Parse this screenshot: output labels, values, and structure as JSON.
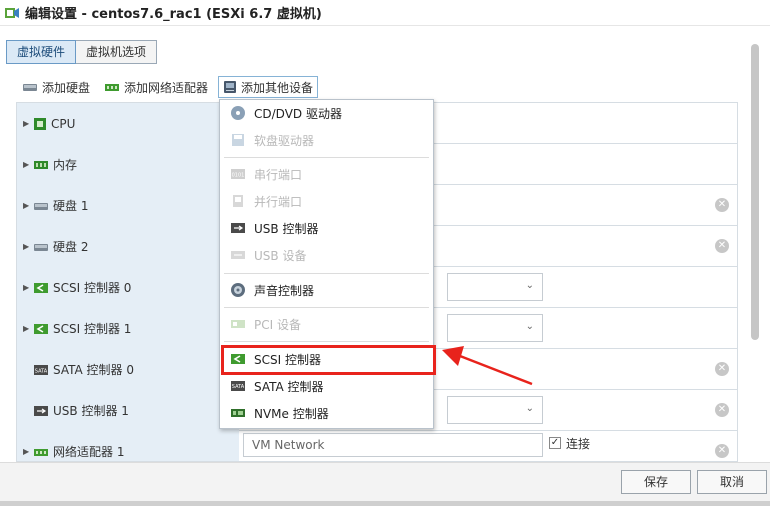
{
  "window": {
    "title": "编辑设置 - centos7.6_rac1 (ESXi 6.7 虚拟机)",
    "icon": "vm-edit-icon"
  },
  "tabs": [
    {
      "label": "虚拟硬件",
      "active": true
    },
    {
      "label": "虚拟机选项",
      "active": false
    }
  ],
  "toolbar": {
    "add_disk": "添加硬盘",
    "add_nic": "添加网络适配器",
    "add_other": "添加其他设备"
  },
  "hardware": [
    {
      "label": "CPU",
      "expandable": true,
      "icon": "cpu-icon"
    },
    {
      "label": "内存",
      "expandable": true,
      "icon": "memory-icon"
    },
    {
      "label": "硬盘 1",
      "expandable": true,
      "icon": "disk-icon"
    },
    {
      "label": "硬盘 2",
      "expandable": true,
      "icon": "disk-icon"
    },
    {
      "label": "SCSI 控制器 0",
      "expandable": true,
      "icon": "scsi-icon"
    },
    {
      "label": "SCSI 控制器 1",
      "expandable": true,
      "icon": "scsi-icon"
    },
    {
      "label": "SATA 控制器 0",
      "expandable": false,
      "icon": "sata-icon"
    },
    {
      "label": "USB 控制器 1",
      "expandable": false,
      "icon": "usb-icon"
    },
    {
      "label": "网络适配器 1",
      "expandable": true,
      "icon": "nic-icon"
    }
  ],
  "network": {
    "value": "VM Network",
    "connect_label": "连接",
    "connected": true
  },
  "menu": {
    "items": [
      {
        "label": "CD/DVD 驱动器",
        "enabled": true,
        "icon": "cdrom-icon"
      },
      {
        "label": "软盘驱动器",
        "enabled": false,
        "icon": "floppy-icon"
      },
      {
        "label": "串行端口",
        "enabled": false,
        "icon": "serial-port-icon"
      },
      {
        "label": "并行端口",
        "enabled": false,
        "icon": "parallel-port-icon"
      },
      {
        "label": "USB 控制器",
        "enabled": true,
        "icon": "usb-icon"
      },
      {
        "label": "USB 设备",
        "enabled": false,
        "icon": "usb-device-icon"
      },
      {
        "label": "声音控制器",
        "enabled": true,
        "icon": "sound-icon"
      },
      {
        "label": "PCI 设备",
        "enabled": false,
        "icon": "pci-icon"
      },
      {
        "label": "SCSI 控制器",
        "enabled": true,
        "icon": "scsi-icon"
      },
      {
        "label": "SATA 控制器",
        "enabled": true,
        "icon": "sata-icon"
      },
      {
        "label": "NVMe 控制器",
        "enabled": true,
        "icon": "nvme-icon"
      }
    ]
  },
  "footer": {
    "save": "保存",
    "cancel": "取消"
  },
  "colors": {
    "accent": "#1d4c7a",
    "highlight": "#e8231c",
    "device_green": "#3f9b2f"
  }
}
